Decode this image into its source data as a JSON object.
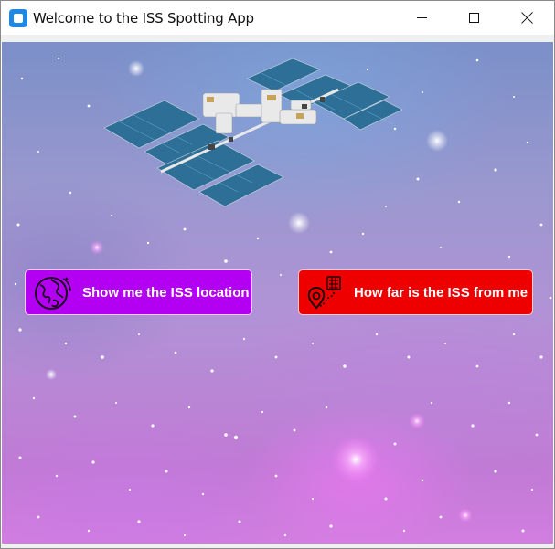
{
  "window": {
    "title": "Welcome to the ISS Spotting App",
    "controls": [
      "minimize",
      "maximize",
      "close"
    ]
  },
  "background": {
    "description": "starry purple nebula sky",
    "image": "iss-space-station"
  },
  "buttons": {
    "location": {
      "label": "Show me the ISS location",
      "icon": "globe-icon",
      "color": "#b400f2"
    },
    "distance": {
      "label": "How far is the ISS from me",
      "icon": "map-pin-distance-icon",
      "color": "#ee0000"
    }
  }
}
